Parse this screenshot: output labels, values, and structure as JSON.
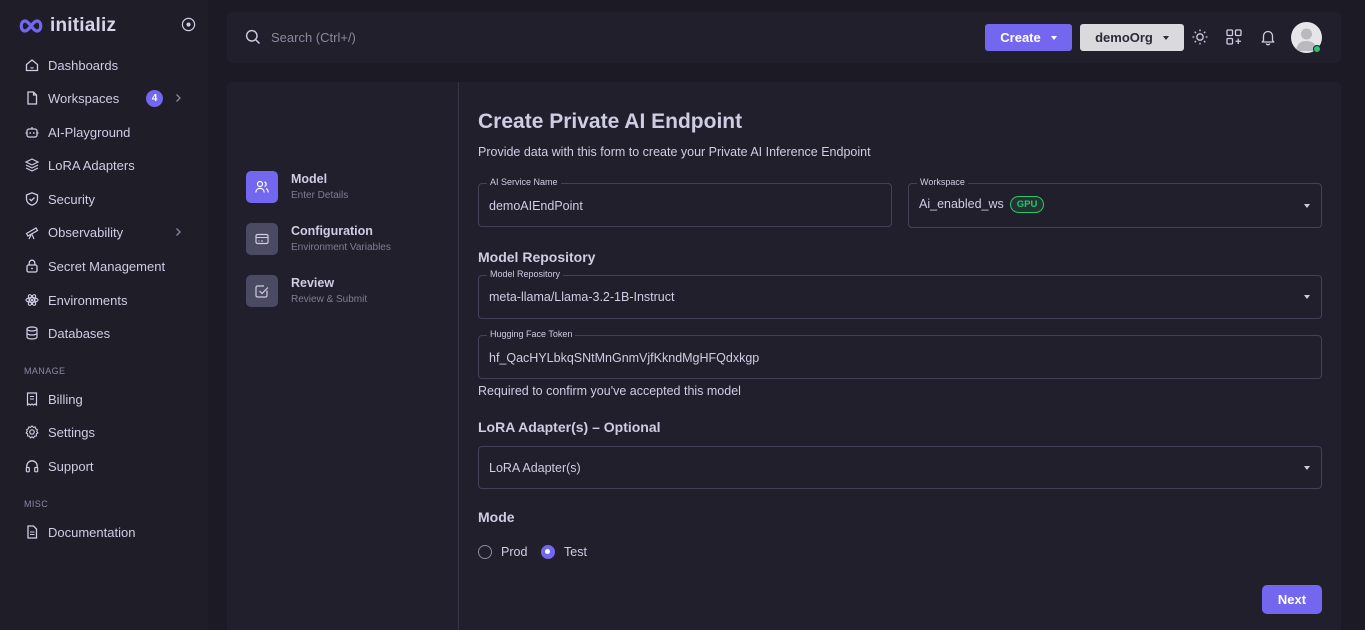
{
  "brand": {
    "name": "initializ",
    "accent": "#7367f0",
    "success": "#28c76f"
  },
  "sidebar": {
    "items": [
      {
        "label": "Dashboards",
        "icon": "smart-home-icon"
      },
      {
        "label": "Workspaces",
        "icon": "file-icon",
        "badge": "4",
        "has_submenu": true
      },
      {
        "label": "AI-Playground",
        "icon": "robot-icon"
      },
      {
        "label": "LoRA Adapters",
        "icon": "stack-icon"
      },
      {
        "label": "Security",
        "icon": "shield-check-icon"
      },
      {
        "label": "Observability",
        "icon": "telescope-icon",
        "has_submenu": true
      },
      {
        "label": "Secret Management",
        "icon": "lock-icon"
      },
      {
        "label": "Environments",
        "icon": "atom-icon"
      },
      {
        "label": "Databases",
        "icon": "database-icon"
      }
    ],
    "manage_label": "MANAGE",
    "manage_items": [
      {
        "label": "Billing",
        "icon": "receipt-icon"
      },
      {
        "label": "Settings",
        "icon": "gear-icon"
      },
      {
        "label": "Support",
        "icon": "headphones-icon"
      }
    ],
    "misc_label": "MISC",
    "misc_items": [
      {
        "label": "Documentation",
        "icon": "file-text-icon"
      }
    ]
  },
  "topbar": {
    "search_placeholder": "Search (Ctrl+/)",
    "create_label": "Create",
    "org_label": "demoOrg",
    "icons": [
      "sun-icon",
      "apps-add-icon",
      "bell-icon"
    ],
    "user_status": "online"
  },
  "stepper": {
    "steps": [
      {
        "title": "Model",
        "subtitle": "Enter Details",
        "active": true,
        "icon": "users-icon"
      },
      {
        "title": "Configuration",
        "subtitle": "Environment Variables",
        "active": false,
        "icon": "credit-card-icon"
      },
      {
        "title": "Review",
        "subtitle": "Review & Submit",
        "active": false,
        "icon": "checkbox-icon"
      }
    ]
  },
  "form": {
    "title": "Create Private AI Endpoint",
    "subtitle": "Provide data with this form to create your Private AI Inference Endpoint",
    "service_name": {
      "label": "AI Service Name",
      "value": "demoAIEndPoint"
    },
    "workspace": {
      "label": "Workspace",
      "value": "Ai_enabled_ws",
      "badge": "GPU"
    },
    "model_repo_heading": "Model Repository",
    "model_repo": {
      "label": "Model Repository",
      "value": "meta-llama/Llama-3.2-1B-Instruct"
    },
    "hf_token": {
      "label": "Hugging Face Token",
      "value": "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"
    },
    "hf_helper": "Required to confirm you've accepted this model",
    "lora_heading": "LoRA Adapter(s) – Optional",
    "lora": {
      "placeholder": "LoRA Adapter(s)"
    },
    "mode_heading": "Mode",
    "mode_options": [
      {
        "label": "Prod",
        "selected": false
      },
      {
        "label": "Test",
        "selected": true
      }
    ],
    "next_label": "Next"
  }
}
